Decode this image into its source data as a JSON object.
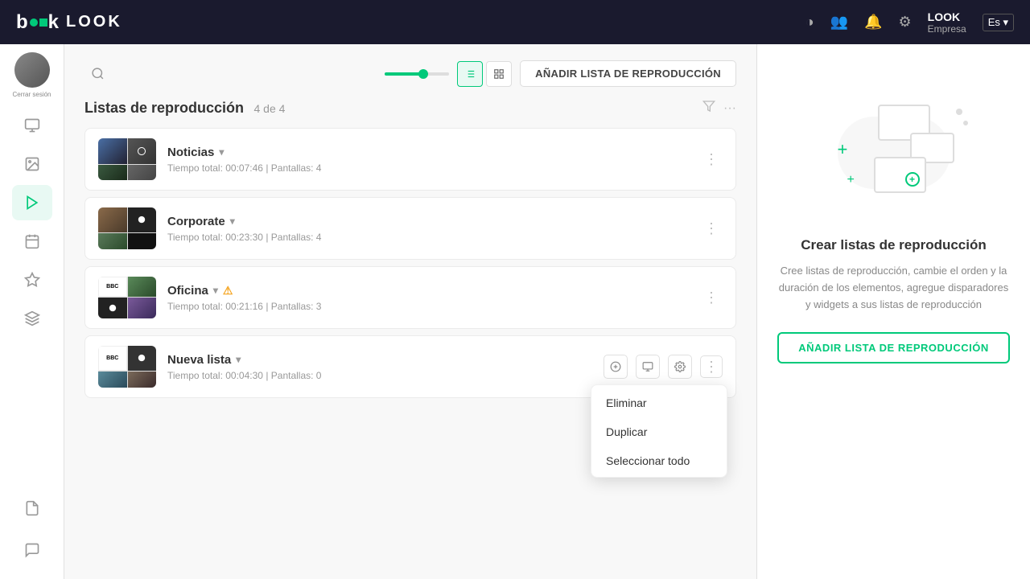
{
  "topbar": {
    "logo": "LOOK",
    "company": "Empresa",
    "lang": "Es",
    "lang_arrow": "▾"
  },
  "sidebar": {
    "username": "Cerrar sesión",
    "items": [
      {
        "icon": "🖥",
        "label": "screens",
        "active": false
      },
      {
        "icon": "🖼",
        "label": "media",
        "active": false
      },
      {
        "icon": "▶",
        "label": "playlists",
        "active": true
      },
      {
        "icon": "📋",
        "label": "schedule",
        "active": false
      },
      {
        "icon": "✦",
        "label": "widgets",
        "active": false
      },
      {
        "icon": "⊞",
        "label": "layers",
        "active": false
      }
    ],
    "bottom_items": [
      {
        "icon": "📄",
        "label": "documents"
      },
      {
        "icon": "💬",
        "label": "messages"
      }
    ]
  },
  "toolbar": {
    "add_label": "AÑADIR LISTA DE REPRODUCCIÓN"
  },
  "section": {
    "title": "Listas de reproducción",
    "count": "4 de 4"
  },
  "playlists": [
    {
      "id": "noticias",
      "name": "Noticias",
      "has_chevron": true,
      "time": "Tiempo total: 00:07:46",
      "screens": "Pantallas: 4",
      "has_warning": false
    },
    {
      "id": "corporate",
      "name": "Corporate",
      "has_chevron": true,
      "time": "Tiempo total: 00:23:30",
      "screens": "Pantallas: 4",
      "has_warning": false
    },
    {
      "id": "oficina",
      "name": "Oficina",
      "has_chevron": true,
      "time": "Tiempo total: 00:21:16",
      "screens": "Pantallas: 3",
      "has_warning": true
    },
    {
      "id": "nueva",
      "name": "Nueva lista",
      "has_chevron": true,
      "time": "Tiempo total: 00:04:30",
      "screens": "Pantallas: 0",
      "has_warning": false,
      "show_actions": true,
      "show_dropdown": true
    }
  ],
  "dropdown": {
    "items": [
      {
        "label": "Eliminar",
        "id": "delete"
      },
      {
        "label": "Duplicar",
        "id": "duplicate"
      },
      {
        "label": "Seleccionar todo",
        "id": "select-all"
      }
    ]
  },
  "right_panel": {
    "title": "Crear listas de reproducción",
    "description": "Cree listas de reproducción, cambie el orden y la duración de los elementos, agregue disparadores y widgets a sus listas de reproducción",
    "add_label": "AÑADIR LISTA DE REPRODUCCIÓN"
  }
}
